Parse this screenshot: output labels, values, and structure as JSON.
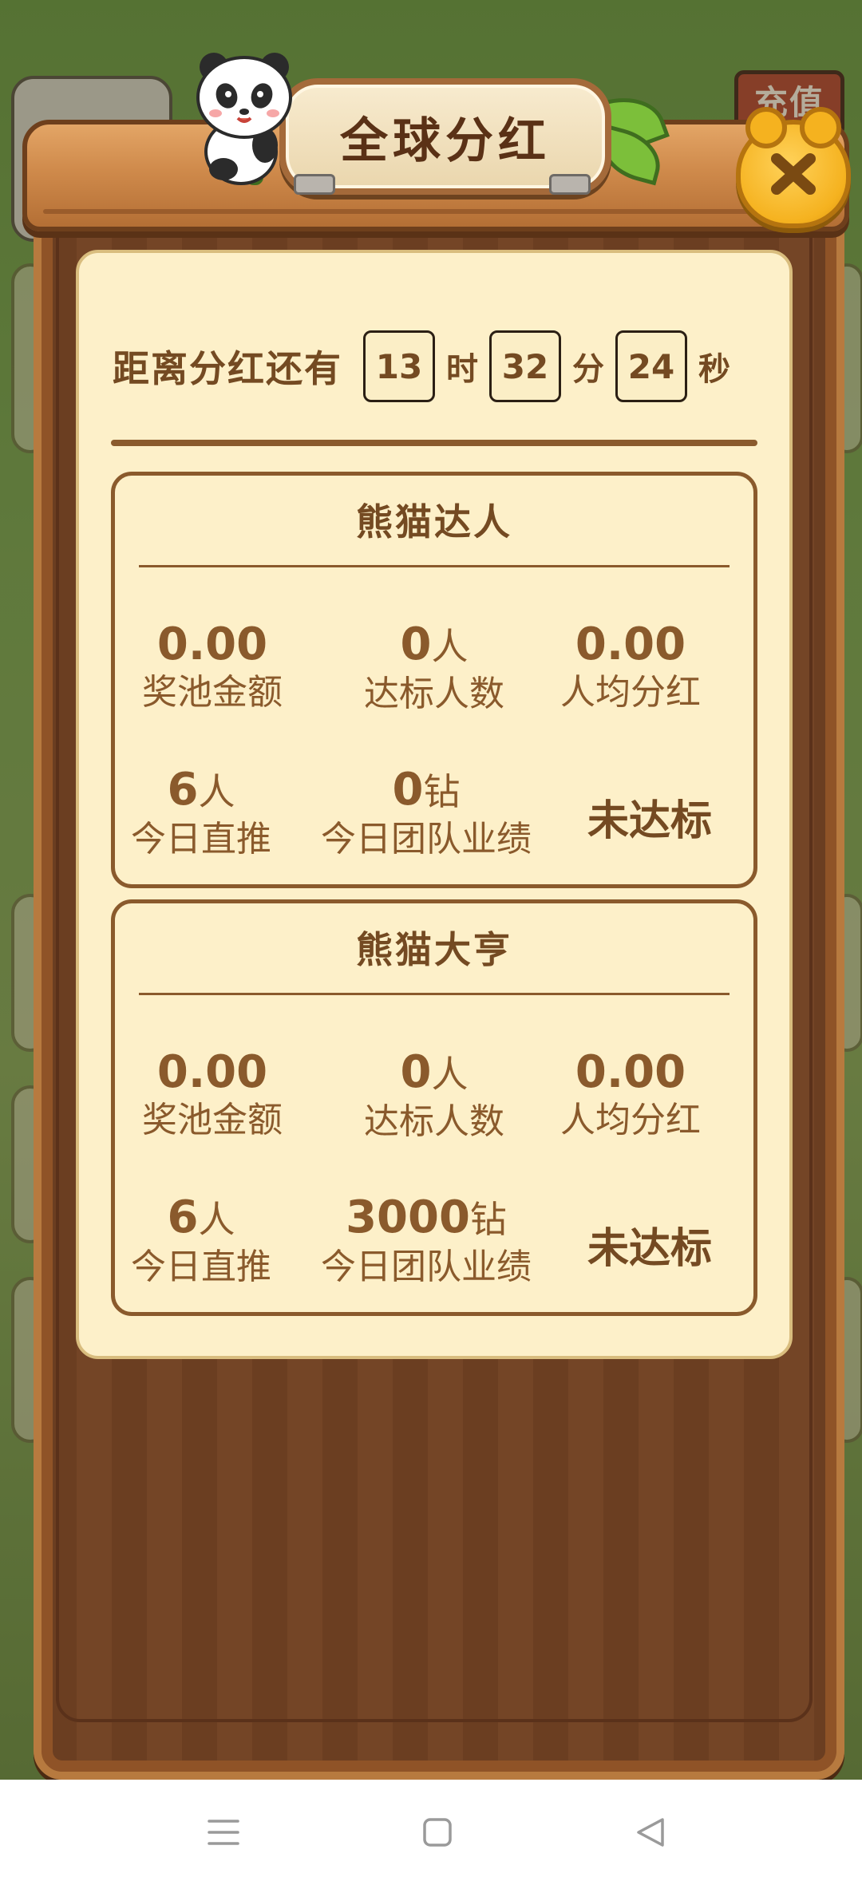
{
  "background": {
    "recharge_label": "充值"
  },
  "modal": {
    "title": "全球分红",
    "countdown": {
      "label": "距离分红还有",
      "hours": "13",
      "hours_unit": "时",
      "minutes": "32",
      "minutes_unit": "分",
      "seconds": "24",
      "seconds_unit": "秒"
    },
    "panels": [
      {
        "title": "熊猫达人",
        "pool_amount": "0.00",
        "pool_label": "奖池金额",
        "qualified_count": "0",
        "qualified_unit": "人",
        "qualified_label": "达标人数",
        "per_person": "0.00",
        "per_person_label": "人均分红",
        "direct_count": "6",
        "direct_unit": "人",
        "direct_label": "今日直推",
        "team_perf": "0",
        "team_unit": "钻",
        "team_label": "今日团队业绩",
        "status": "未达标"
      },
      {
        "title": "熊猫大亨",
        "pool_amount": "0.00",
        "pool_label": "奖池金额",
        "qualified_count": "0",
        "qualified_unit": "人",
        "qualified_label": "达标人数",
        "per_person": "0.00",
        "per_person_label": "人均分红",
        "direct_count": "6",
        "direct_unit": "人",
        "direct_label": "今日直推",
        "team_perf": "3000",
        "team_unit": "钻",
        "team_label": "今日团队业绩",
        "status": "未达标"
      }
    ]
  },
  "colors": {
    "wood_dark": "#6b3e21",
    "card_bg": "#fdf0c9",
    "text_brown": "#744a22",
    "close_gold": "#f5b21f"
  },
  "icons": {
    "close": "close-x-icon",
    "nav_menu": "menu-lines-icon",
    "nav_home": "square-home-icon",
    "nav_back": "triangle-back-icon"
  }
}
